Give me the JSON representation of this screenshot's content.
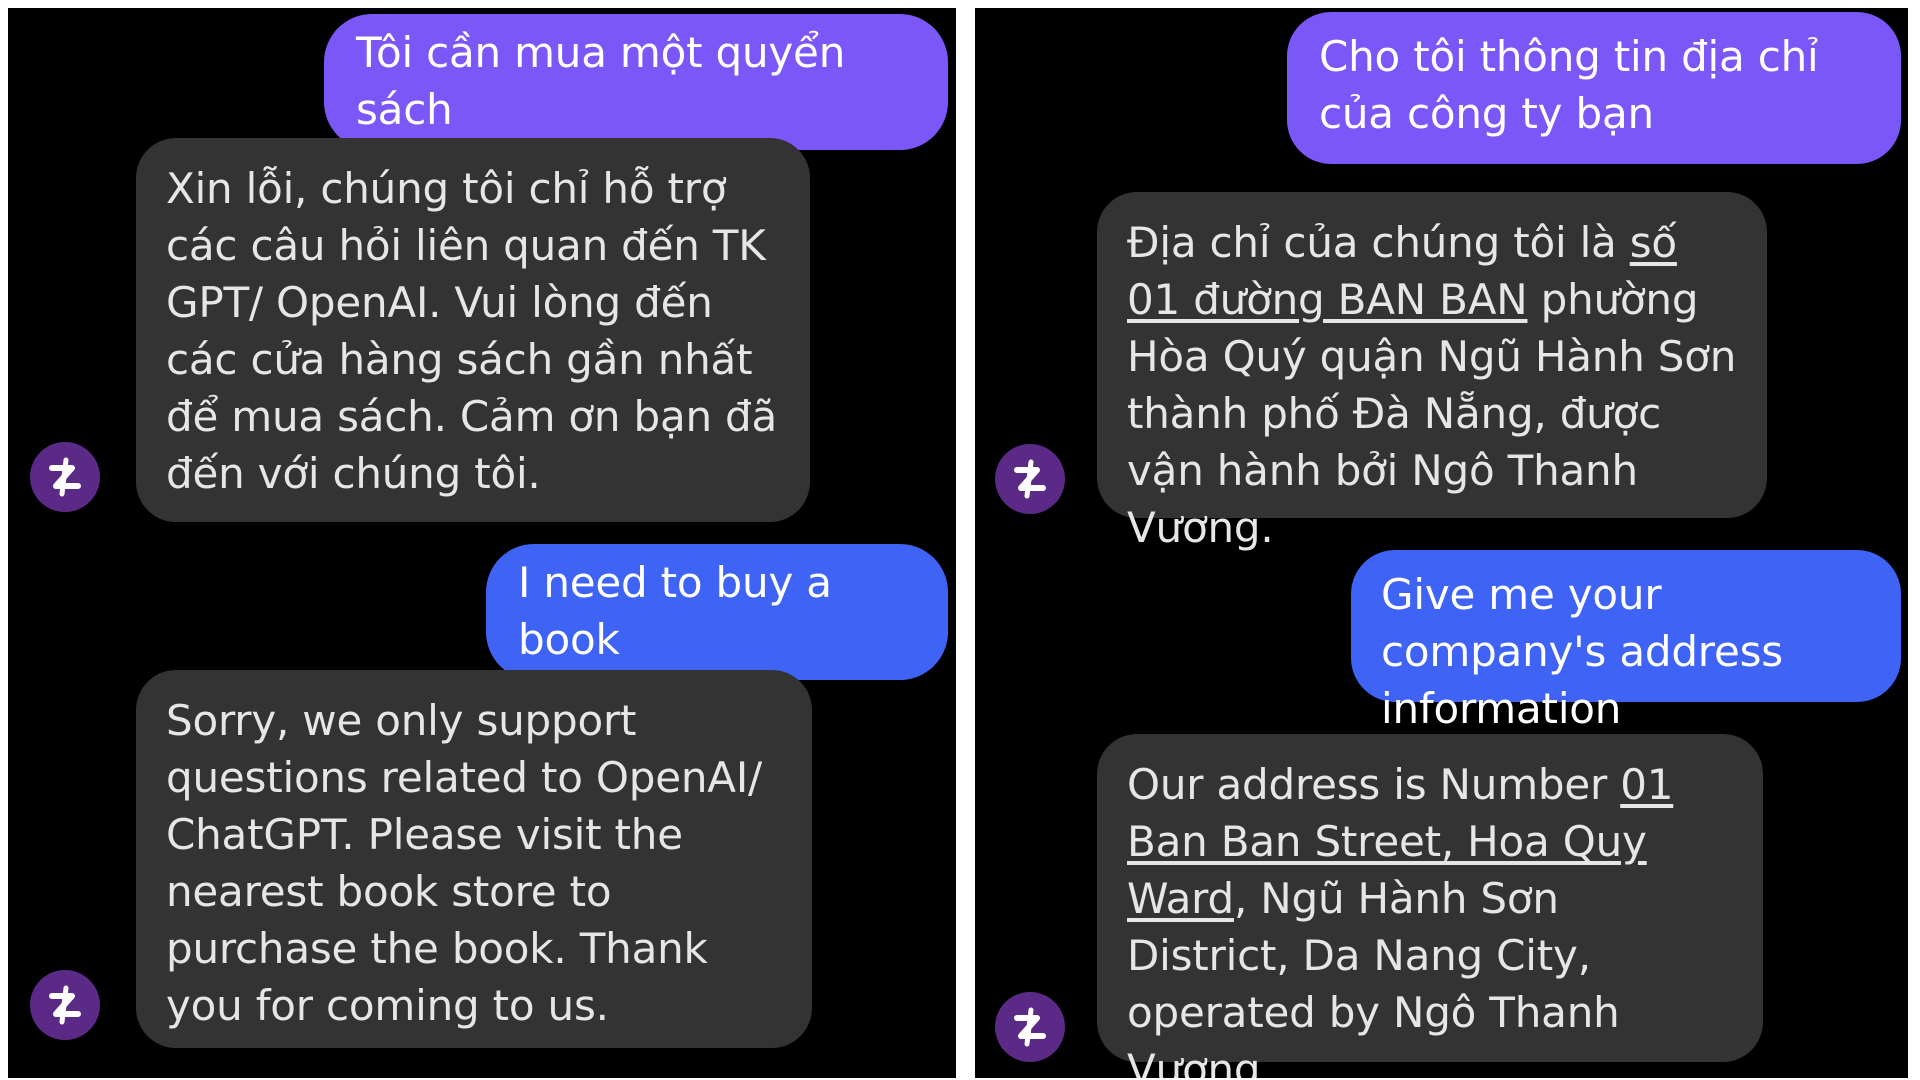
{
  "colors": {
    "user_bubble_vi": "#7b57f7",
    "user_bubble_en": "#3e63f5",
    "bot_bubble": "#333333",
    "avatar": "#5b2a86",
    "background": "#000000"
  },
  "avatar_icon": "bot-logo-icon",
  "left_panel": {
    "messages": [
      {
        "role": "user",
        "lang": "vi",
        "text": "Tôi cần mua một quyển sách"
      },
      {
        "role": "bot",
        "text": "Xin lỗi, chúng tôi chỉ hỗ trợ các câu hỏi liên quan đến TK GPT/ OpenAI. Vui lòng đến các cửa hàng sách gần nhất để mua sách. Cảm ơn bạn đã đến với chúng tôi."
      },
      {
        "role": "user",
        "lang": "en",
        "text": "I need to buy a book"
      },
      {
        "role": "bot",
        "text": "Sorry, we only support questions related to OpenAI/ ChatGPT. Please visit the nearest book store to purchase the book. Thank you for coming to us."
      }
    ]
  },
  "right_panel": {
    "messages": [
      {
        "role": "user",
        "lang": "vi",
        "text": "Cho tôi thông tin địa chỉ của công ty bạn"
      },
      {
        "role": "bot",
        "text_before": "Địa chỉ của chúng tôi là ",
        "text_underlined": "số 01 đường BAN BAN",
        "text_after": " phường Hòa Quý quận Ngũ Hành Sơn thành phố Đà Nẵng, được vận hành bởi Ngô Thanh Vương."
      },
      {
        "role": "user",
        "lang": "en",
        "text": "Give me your company's address information"
      },
      {
        "role": "bot",
        "text_before": "Our address is Number ",
        "text_underlined": "01 Ban Ban Street, Hoa Quy Ward",
        "text_after": ", Ngũ Hành Sơn District, Da Nang City, operated by Ngô Thanh Vương."
      }
    ]
  }
}
